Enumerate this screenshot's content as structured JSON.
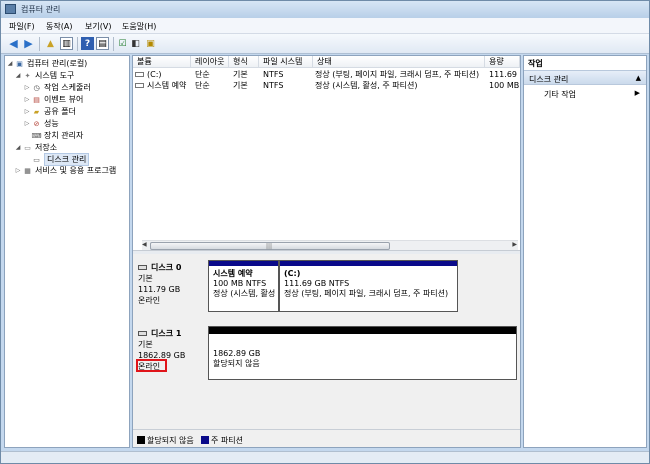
{
  "window": {
    "title": "컴퓨터 관리"
  },
  "menu": [
    "파일(F)",
    "동작(A)",
    "보기(V)",
    "도움말(H)"
  ],
  "toolbar": [
    "back-icon",
    "forward-icon",
    "up-folder-icon",
    "show-hide-tree-icon",
    "properties-icon",
    "help-icon",
    "export-list-icon",
    "connect-icon",
    "check-icon"
  ],
  "tree": {
    "root": "컴퓨터 관리(로컬)",
    "system_tools": "시스템 도구",
    "task_scheduler": "작업 스케줄러",
    "event_viewer": "이벤트 뷰어",
    "shared_folders": "공유 폴더",
    "performance": "성능",
    "device_manager": "장치 관리자",
    "storage": "저장소",
    "disk_management": "디스크 관리",
    "services": "서비스 및 응용 프로그램"
  },
  "volume_list": {
    "columns": [
      "볼륨",
      "레이아웃",
      "형식",
      "파일 시스템",
      "상태",
      "용량"
    ],
    "rows": [
      [
        "(C:)",
        "단순",
        "기본",
        "NTFS",
        "정상 (부팅, 페이지 파일, 크래시 덤프, 주 파티션)",
        "111.69 ("
      ],
      [
        "시스템 예약",
        "단순",
        "기본",
        "NTFS",
        "정상 (시스템, 활성, 주 파티션)",
        "100 MB"
      ]
    ]
  },
  "disk0": {
    "name": "디스크 0",
    "type": "기본",
    "size": "111.79 GB",
    "status": "온라인",
    "partitions": [
      {
        "name": "시스템 예약",
        "detail": "100 MB NTFS",
        "status": "정상 (시스템, 활성"
      },
      {
        "name": "(C:)",
        "detail": "111.69 GB NTFS",
        "status": "정상 (부팅, 페이지 파일, 크래시 덤프, 주 파티션)"
      }
    ]
  },
  "disk1": {
    "name": "디스크 1",
    "type": "기본",
    "size": "1862.89 GB",
    "status": "온라인",
    "partition": {
      "detail": "1862.89 GB",
      "status": "할당되지 않음"
    }
  },
  "legend": {
    "unallocated": "할당되지 않음",
    "primary": "주 파티션"
  },
  "actions": {
    "title": "작업",
    "section": "디스크 관리",
    "more": "기타 작업"
  },
  "colors": {
    "primary_partition": "#0a0a8a",
    "unallocated": "#000000",
    "highlight": "#e0141a"
  }
}
